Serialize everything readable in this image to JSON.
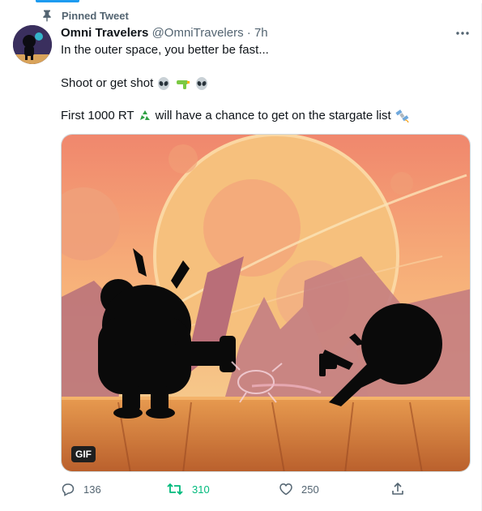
{
  "pinned": {
    "label": "Pinned Tweet"
  },
  "tweet": {
    "author_name": "Omni Travelers",
    "handle": "@OmniTravelers",
    "separator": "·",
    "time": "7h",
    "line1": "In the outer space, you better be fast...",
    "line2": "Shoot or get shot",
    "line3_a": "First 1000 RT",
    "line3_b": "will have a chance to get on the stargate list"
  },
  "media": {
    "badge": "GIF"
  },
  "actions": {
    "replies": "136",
    "retweets": "310",
    "likes": "250"
  },
  "colors": {
    "accent": "#1d9bf0",
    "retweet_green": "#00ba7c",
    "muted": "#536471"
  }
}
